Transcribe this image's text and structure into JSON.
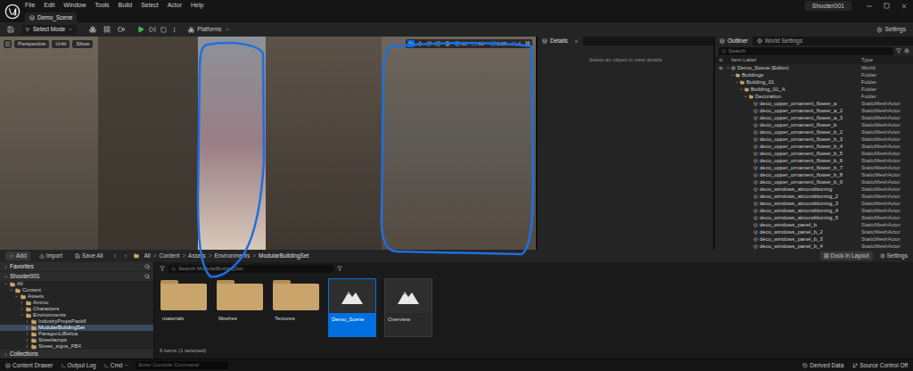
{
  "window": {
    "tab": "Demo_Scene",
    "project": "Shooter001"
  },
  "menu": [
    "File",
    "Edit",
    "Window",
    "Tools",
    "Build",
    "Select",
    "Actor",
    "Help"
  ],
  "toolbar": {
    "mode": "Select Mode",
    "platforms": "Platforms",
    "settings": "Settings"
  },
  "viewport": {
    "view_buttons": [
      "Perspective",
      "Unlit",
      "Show"
    ],
    "tools": [
      {
        "kind": "select",
        "selected": true
      },
      {
        "kind": "move",
        "selected": false
      },
      {
        "kind": "rotate",
        "selected": false
      },
      {
        "kind": "scale",
        "selected": false
      }
    ],
    "snap_values": [
      "10",
      "90°",
      "0.25",
      "4"
    ]
  },
  "details": {
    "tab": "Details",
    "empty": "Select an object to view details"
  },
  "outliner": {
    "tabs": [
      {
        "label": "Outliner",
        "selected": true
      },
      {
        "label": "World Settings",
        "selected": false
      }
    ],
    "search": "Search",
    "columns": [
      "Item Label",
      "Type"
    ],
    "rows": [
      {
        "label": "Demo_Scene (Editor)",
        "type": "World",
        "depth": 0,
        "kind": "world",
        "expanded": true
      },
      {
        "label": "Buildings",
        "type": "Folder",
        "depth": 1,
        "kind": "folder",
        "expanded": true
      },
      {
        "label": "Building_01",
        "type": "Folder",
        "depth": 2,
        "kind": "folder",
        "expanded": true
      },
      {
        "label": "Building_01_A",
        "type": "Folder",
        "depth": 3,
        "kind": "folder",
        "expanded": true
      },
      {
        "label": "Decoration",
        "type": "Folder",
        "depth": 4,
        "kind": "folder",
        "expanded": true
      },
      {
        "label": "deco_upper_ornament_flower_a",
        "type": "StaticMeshActor",
        "depth": 5,
        "kind": "mesh",
        "expanded": false
      },
      {
        "label": "deco_upper_ornament_flower_a_2",
        "type": "StaticMeshActor",
        "depth": 5,
        "kind": "mesh",
        "expanded": false
      },
      {
        "label": "deco_upper_ornament_flower_a_3",
        "type": "StaticMeshActor",
        "depth": 5,
        "kind": "mesh",
        "expanded": false
      },
      {
        "label": "deco_upper_ornament_flower_b",
        "type": "StaticMeshActor",
        "depth": 5,
        "kind": "mesh",
        "expanded": false
      },
      {
        "label": "deco_upper_ornament_flower_b_2",
        "type": "StaticMeshActor",
        "depth": 5,
        "kind": "mesh",
        "expanded": false
      },
      {
        "label": "deco_upper_ornament_flower_b_3",
        "type": "StaticMeshActor",
        "depth": 5,
        "kind": "mesh",
        "expanded": false
      },
      {
        "label": "deco_upper_ornament_flower_b_4",
        "type": "StaticMeshActor",
        "depth": 5,
        "kind": "mesh",
        "expanded": false
      },
      {
        "label": "deco_upper_ornament_flower_b_5",
        "type": "StaticMeshActor",
        "depth": 5,
        "kind": "mesh",
        "expanded": false
      },
      {
        "label": "deco_upper_ornament_flower_b_6",
        "type": "StaticMeshActor",
        "depth": 5,
        "kind": "mesh",
        "expanded": false
      },
      {
        "label": "deco_upper_ornament_flower_b_7",
        "type": "StaticMeshActor",
        "depth": 5,
        "kind": "mesh",
        "expanded": false
      },
      {
        "label": "deco_upper_ornament_flower_b_8",
        "type": "StaticMeshActor",
        "depth": 5,
        "kind": "mesh",
        "expanded": false
      },
      {
        "label": "deco_upper_ornament_flower_b_9",
        "type": "StaticMeshActor",
        "depth": 5,
        "kind": "mesh",
        "expanded": false
      },
      {
        "label": "deco_windows_airconditioning",
        "type": "StaticMeshActor",
        "depth": 5,
        "kind": "mesh",
        "expanded": false
      },
      {
        "label": "deco_windows_airconditioning_2",
        "type": "StaticMeshActor",
        "depth": 5,
        "kind": "mesh",
        "expanded": false
      },
      {
        "label": "deco_windows_airconditioning_3",
        "type": "StaticMeshActor",
        "depth": 5,
        "kind": "mesh",
        "expanded": false
      },
      {
        "label": "deco_windows_airconditioning_4",
        "type": "StaticMeshActor",
        "depth": 5,
        "kind": "mesh",
        "expanded": false
      },
      {
        "label": "deco_windows_airconditioning_5",
        "type": "StaticMeshActor",
        "depth": 5,
        "kind": "mesh",
        "expanded": false
      },
      {
        "label": "deco_windows_panel_b",
        "type": "StaticMeshActor",
        "depth": 5,
        "kind": "mesh",
        "expanded": false
      },
      {
        "label": "deco_windows_panel_b_2",
        "type": "StaticMeshActor",
        "depth": 5,
        "kind": "mesh",
        "expanded": false
      },
      {
        "label": "deco_windows_panel_b_3",
        "type": "StaticMeshActor",
        "depth": 5,
        "kind": "mesh",
        "expanded": false
      },
      {
        "label": "deco_windows_panel_b_4",
        "type": "StaticMeshActor",
        "depth": 5,
        "kind": "mesh",
        "expanded": false
      }
    ]
  },
  "content_browser": {
    "buttons": [
      "Add",
      "Import",
      "Save All"
    ],
    "breadcrumb": [
      "All",
      "Content",
      "Assets",
      "Environments",
      "ModularBuildingSet"
    ],
    "separator": ">",
    "dock": "Dock in Layout",
    "settings": "Settings",
    "favorites": "Favorites",
    "project": "Shooter001",
    "tree": [
      {
        "label": "All",
        "depth": 0,
        "expanded": true,
        "selected": false
      },
      {
        "label": "Content",
        "depth": 1,
        "expanded": true,
        "selected": false
      },
      {
        "label": "Assets",
        "depth": 2,
        "expanded": true,
        "selected": false
      },
      {
        "label": "Ammo",
        "depth": 3,
        "expanded": false,
        "selected": false
      },
      {
        "label": "Characters",
        "depth": 3,
        "expanded": false,
        "selected": false
      },
      {
        "label": "Environments",
        "depth": 3,
        "expanded": true,
        "selected": false
      },
      {
        "label": "IndustryPropsPack6",
        "depth": 4,
        "expanded": false,
        "selected": false
      },
      {
        "label": "ModularBuildingSet",
        "depth": 4,
        "expanded": false,
        "selected": true
      },
      {
        "label": "ParagonLtBelica",
        "depth": 4,
        "expanded": false,
        "selected": false
      },
      {
        "label": "Streetlamps",
        "depth": 4,
        "expanded": false,
        "selected": false
      },
      {
        "label": "Street_signs_FBX",
        "depth": 4,
        "expanded": false,
        "selected": false
      }
    ],
    "collections": "Collections",
    "search": "Search ModularBuildingSet",
    "assets": [
      {
        "label": "materials",
        "kind": "folder",
        "selected": false
      },
      {
        "label": "Meshes",
        "kind": "folder",
        "selected": false
      },
      {
        "label": "Textures",
        "kind": "folder",
        "selected": false
      },
      {
        "label": "Demo_Scene",
        "kind": "map",
        "selected": true
      },
      {
        "label": "Overview",
        "kind": "map",
        "selected": false
      }
    ],
    "count": "6 items (1 selected)"
  },
  "status_bar": {
    "left": [
      "Content Drawer",
      "Output Log"
    ],
    "cmd": "Cmd",
    "console": "Enter Console Command",
    "right": [
      "Derived Data",
      "Source Control Off"
    ]
  }
}
